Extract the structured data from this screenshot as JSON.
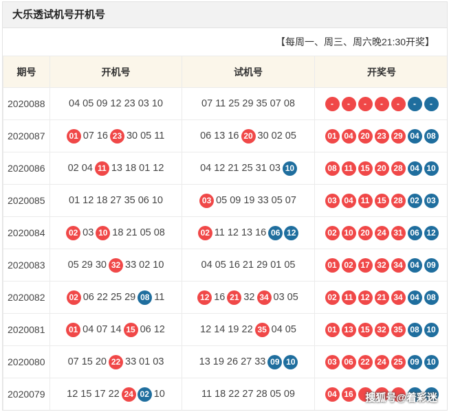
{
  "header": {
    "title": "大乐透试机号开机号"
  },
  "note": "【每周一、周三、周六晚21:30开奖】",
  "columns": [
    "期号",
    "开机号",
    "试机号",
    "开奖号"
  ],
  "colors": {
    "red": "#f04848",
    "blue": "#1f6e9e"
  },
  "watermark": "搜狐号@着彩迷",
  "rows": [
    {
      "issue": "2020088",
      "kaiji": [
        [
          "04",
          "n"
        ],
        [
          "05",
          "n"
        ],
        [
          "09",
          "n"
        ],
        [
          "12",
          "n"
        ],
        [
          "23",
          "n"
        ],
        [
          "03",
          "n"
        ],
        [
          "10",
          "n"
        ]
      ],
      "shiji": [
        [
          "07",
          "n"
        ],
        [
          "11",
          "n"
        ],
        [
          "25",
          "n"
        ],
        [
          "29",
          "n"
        ],
        [
          "35",
          "n"
        ],
        [
          "07",
          "n"
        ],
        [
          "08",
          "n"
        ]
      ],
      "result": [
        [
          "-",
          "r"
        ],
        [
          "-",
          "r"
        ],
        [
          "-",
          "r"
        ],
        [
          "-",
          "r"
        ],
        [
          "-",
          "r"
        ],
        [
          "-",
          "u"
        ],
        [
          "-",
          "u"
        ]
      ]
    },
    {
      "issue": "2020087",
      "kaiji": [
        [
          "01",
          "r"
        ],
        [
          "07",
          "n"
        ],
        [
          "16",
          "n"
        ],
        [
          "23",
          "r"
        ],
        [
          "30",
          "n"
        ],
        [
          "05",
          "n"
        ],
        [
          "11",
          "n"
        ]
      ],
      "shiji": [
        [
          "06",
          "n"
        ],
        [
          "13",
          "n"
        ],
        [
          "16",
          "n"
        ],
        [
          "20",
          "r"
        ],
        [
          "30",
          "n"
        ],
        [
          "02",
          "n"
        ],
        [
          "05",
          "n"
        ]
      ],
      "result": [
        [
          "01",
          "r"
        ],
        [
          "04",
          "r"
        ],
        [
          "20",
          "r"
        ],
        [
          "23",
          "r"
        ],
        [
          "29",
          "r"
        ],
        [
          "04",
          "u"
        ],
        [
          "08",
          "u"
        ]
      ]
    },
    {
      "issue": "2020086",
      "kaiji": [
        [
          "02",
          "n"
        ],
        [
          "04",
          "n"
        ],
        [
          "11",
          "r"
        ],
        [
          "13",
          "n"
        ],
        [
          "18",
          "n"
        ],
        [
          "01",
          "n"
        ],
        [
          "12",
          "n"
        ]
      ],
      "shiji": [
        [
          "04",
          "n"
        ],
        [
          "12",
          "n"
        ],
        [
          "21",
          "n"
        ],
        [
          "25",
          "n"
        ],
        [
          "31",
          "n"
        ],
        [
          "03",
          "n"
        ],
        [
          "10",
          "u"
        ]
      ],
      "result": [
        [
          "08",
          "r"
        ],
        [
          "11",
          "r"
        ],
        [
          "15",
          "r"
        ],
        [
          "20",
          "r"
        ],
        [
          "28",
          "r"
        ],
        [
          "04",
          "u"
        ],
        [
          "10",
          "u"
        ]
      ]
    },
    {
      "issue": "2020085",
      "kaiji": [
        [
          "01",
          "n"
        ],
        [
          "12",
          "n"
        ],
        [
          "18",
          "n"
        ],
        [
          "27",
          "n"
        ],
        [
          "35",
          "n"
        ],
        [
          "06",
          "n"
        ],
        [
          "10",
          "n"
        ]
      ],
      "shiji": [
        [
          "03",
          "r"
        ],
        [
          "05",
          "n"
        ],
        [
          "09",
          "n"
        ],
        [
          "19",
          "n"
        ],
        [
          "33",
          "n"
        ],
        [
          "05",
          "n"
        ],
        [
          "07",
          "n"
        ]
      ],
      "result": [
        [
          "03",
          "r"
        ],
        [
          "04",
          "r"
        ],
        [
          "11",
          "r"
        ],
        [
          "15",
          "r"
        ],
        [
          "28",
          "r"
        ],
        [
          "02",
          "u"
        ],
        [
          "03",
          "u"
        ]
      ]
    },
    {
      "issue": "2020084",
      "kaiji": [
        [
          "02",
          "r"
        ],
        [
          "03",
          "n"
        ],
        [
          "10",
          "r"
        ],
        [
          "18",
          "n"
        ],
        [
          "21",
          "n"
        ],
        [
          "05",
          "n"
        ],
        [
          "08",
          "n"
        ]
      ],
      "shiji": [
        [
          "02",
          "r"
        ],
        [
          "11",
          "n"
        ],
        [
          "12",
          "n"
        ],
        [
          "13",
          "n"
        ],
        [
          "16",
          "n"
        ],
        [
          "06",
          "u"
        ],
        [
          "12",
          "u"
        ]
      ],
      "result": [
        [
          "02",
          "r"
        ],
        [
          "10",
          "r"
        ],
        [
          "20",
          "r"
        ],
        [
          "24",
          "r"
        ],
        [
          "31",
          "r"
        ],
        [
          "06",
          "u"
        ],
        [
          "12",
          "u"
        ]
      ]
    },
    {
      "issue": "2020083",
      "kaiji": [
        [
          "05",
          "n"
        ],
        [
          "29",
          "n"
        ],
        [
          "30",
          "n"
        ],
        [
          "32",
          "r"
        ],
        [
          "33",
          "n"
        ],
        [
          "02",
          "n"
        ],
        [
          "10",
          "n"
        ]
      ],
      "shiji": [
        [
          "04",
          "n"
        ],
        [
          "05",
          "n"
        ],
        [
          "16",
          "n"
        ],
        [
          "21",
          "n"
        ],
        [
          "29",
          "n"
        ],
        [
          "01",
          "n"
        ],
        [
          "05",
          "n"
        ]
      ],
      "result": [
        [
          "01",
          "r"
        ],
        [
          "02",
          "r"
        ],
        [
          "17",
          "r"
        ],
        [
          "32",
          "r"
        ],
        [
          "34",
          "r"
        ],
        [
          "04",
          "u"
        ],
        [
          "09",
          "u"
        ]
      ]
    },
    {
      "issue": "2020082",
      "kaiji": [
        [
          "02",
          "r"
        ],
        [
          "06",
          "n"
        ],
        [
          "22",
          "n"
        ],
        [
          "25",
          "n"
        ],
        [
          "29",
          "n"
        ],
        [
          "08",
          "u"
        ],
        [
          "11",
          "n"
        ]
      ],
      "shiji": [
        [
          "12",
          "r"
        ],
        [
          "16",
          "n"
        ],
        [
          "21",
          "r"
        ],
        [
          "32",
          "n"
        ],
        [
          "34",
          "r"
        ],
        [
          "03",
          "n"
        ],
        [
          "05",
          "n"
        ]
      ],
      "result": [
        [
          "02",
          "r"
        ],
        [
          "11",
          "r"
        ],
        [
          "12",
          "r"
        ],
        [
          "21",
          "r"
        ],
        [
          "34",
          "r"
        ],
        [
          "04",
          "u"
        ],
        [
          "08",
          "u"
        ]
      ]
    },
    {
      "issue": "2020081",
      "kaiji": [
        [
          "01",
          "r"
        ],
        [
          "04",
          "n"
        ],
        [
          "07",
          "n"
        ],
        [
          "14",
          "n"
        ],
        [
          "15",
          "r"
        ],
        [
          "06",
          "n"
        ],
        [
          "12",
          "n"
        ]
      ],
      "shiji": [
        [
          "12",
          "n"
        ],
        [
          "14",
          "n"
        ],
        [
          "19",
          "n"
        ],
        [
          "22",
          "n"
        ],
        [
          "35",
          "r"
        ],
        [
          "04",
          "n"
        ],
        [
          "05",
          "n"
        ]
      ],
      "result": [
        [
          "01",
          "r"
        ],
        [
          "13",
          "r"
        ],
        [
          "15",
          "r"
        ],
        [
          "32",
          "r"
        ],
        [
          "35",
          "r"
        ],
        [
          "08",
          "u"
        ],
        [
          "10",
          "u"
        ]
      ]
    },
    {
      "issue": "2020080",
      "kaiji": [
        [
          "07",
          "n"
        ],
        [
          "15",
          "n"
        ],
        [
          "20",
          "n"
        ],
        [
          "22",
          "r"
        ],
        [
          "33",
          "n"
        ],
        [
          "01",
          "n"
        ],
        [
          "03",
          "n"
        ]
      ],
      "shiji": [
        [
          "13",
          "n"
        ],
        [
          "19",
          "n"
        ],
        [
          "26",
          "n"
        ],
        [
          "27",
          "n"
        ],
        [
          "33",
          "n"
        ],
        [
          "09",
          "u"
        ],
        [
          "10",
          "u"
        ]
      ],
      "result": [
        [
          "03",
          "r"
        ],
        [
          "06",
          "r"
        ],
        [
          "22",
          "r"
        ],
        [
          "24",
          "r"
        ],
        [
          "25",
          "r"
        ],
        [
          "09",
          "u"
        ],
        [
          "10",
          "u"
        ]
      ]
    },
    {
      "issue": "2020079",
      "kaiji": [
        [
          "12",
          "n"
        ],
        [
          "15",
          "n"
        ],
        [
          "17",
          "n"
        ],
        [
          "22",
          "n"
        ],
        [
          "24",
          "r"
        ],
        [
          "02",
          "u"
        ],
        [
          "10",
          "n"
        ]
      ],
      "shiji": [
        [
          "11",
          "n"
        ],
        [
          "18",
          "n"
        ],
        [
          "22",
          "n"
        ],
        [
          "27",
          "n"
        ],
        [
          "28",
          "n"
        ],
        [
          "05",
          "n"
        ],
        [
          "09",
          "n"
        ]
      ],
      "result": [
        [
          "04",
          "r"
        ],
        [
          "16",
          "r"
        ],
        [
          "",
          "r"
        ],
        [
          "",
          "r"
        ],
        [
          "",
          "r"
        ],
        [
          "",
          "u"
        ],
        [
          "",
          "u"
        ]
      ]
    }
  ]
}
